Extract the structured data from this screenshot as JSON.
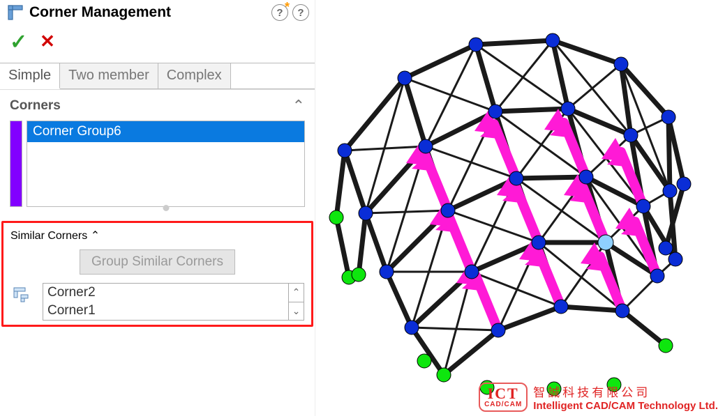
{
  "header": {
    "title": "Corner Management"
  },
  "tabs": {
    "simple": "Simple",
    "two_member": "Two member",
    "complex": "Complex",
    "active": "simple"
  },
  "corners_section": {
    "title": "Corners",
    "items": [
      "Corner Group6"
    ],
    "color": "#8200ff"
  },
  "similar_section": {
    "title": "Similar Corners",
    "button": "Group Similar Corners",
    "items": [
      "Corner2",
      "Corner1"
    ]
  },
  "watermark": {
    "logo_line1": "ICT",
    "logo_line2": "CAD/CAM",
    "cn": "智誠科技有限公司",
    "en": "Intelligent CAD/CAM Technology Ltd."
  }
}
